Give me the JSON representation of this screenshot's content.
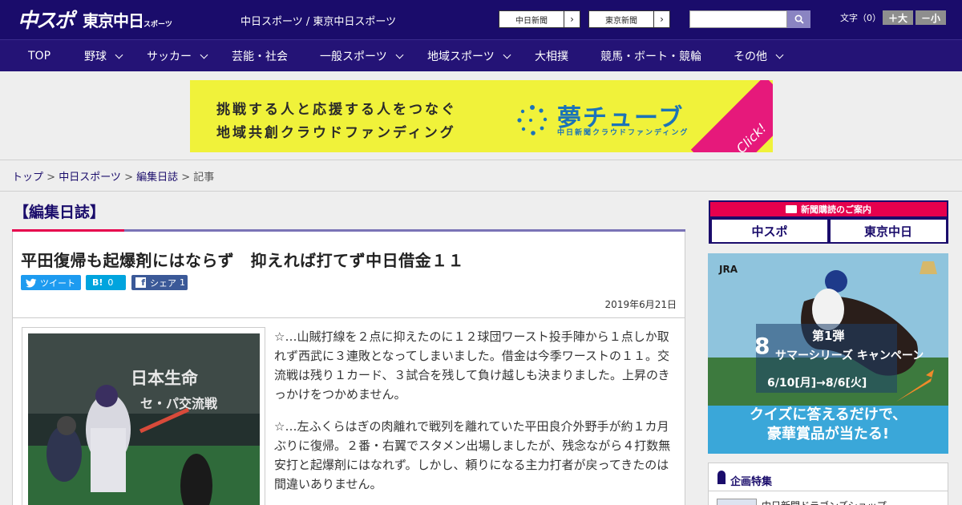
{
  "header": {
    "logo_chunichi": "中スポ",
    "logo_tokyo": "東京中日",
    "logo_tokyo_small": "スポーツ",
    "site_label": "中日スポーツ / 東京中日スポーツ",
    "paper_buttons": [
      "中日新聞",
      "東京新聞"
    ],
    "font_size_label": "文字（0）",
    "font_larger": "＋大",
    "font_smaller": "－小"
  },
  "nav": {
    "items": [
      {
        "label": "TOP"
      },
      {
        "label": "野球"
      },
      {
        "label": "サッカー"
      },
      {
        "label": "芸能・社会"
      },
      {
        "label": "一般スポーツ"
      },
      {
        "label": "地域スポーツ"
      },
      {
        "label": "大相撲"
      },
      {
        "label": "競馬・ボート・競輪"
      },
      {
        "label": "その他"
      }
    ]
  },
  "banner": {
    "line1": "挑戦する人と応援する人をつなぐ",
    "line2": "地域共創クラウドファンディング",
    "brand": "夢チューブ",
    "brand_sub": "中日新聞クラウドファンディング",
    "click": "Click!"
  },
  "breadcrumb": {
    "top": "トップ",
    "site": "中日スポーツ",
    "category": "編集日誌",
    "current": "記事"
  },
  "article": {
    "section": "【編集日誌】",
    "headline": "平田復帰も起爆剤にはならず　抑えれば打てず中日借金１１",
    "tweet_label": "ツイート",
    "hatena_label": "B!",
    "hatena_count": "0",
    "facebook_label": "シェア",
    "facebook_count": "1",
    "date": "2019年6月21日",
    "paragraphs": [
      "☆…山賊打線を２点に抑えたのに１２球団ワースト投手陣から１点しか取れず西武に３連敗となってしまいました。借金は今季ワーストの１１。交流戦は残り１カード、３試合を残して負け越しも決まりました。上昇のきっかけをつかめません。",
      "☆…左ふくらはぎの肉離れで戦列を離れていた平田良介外野手が約１カ月ぶりに復帰。２番・右翼でスタメン出場しましたが、残念ながら４打数無安打と起爆剤にはなれず。しかし、頼りになる主力打者が戻ってきたのは間違いありません。"
    ],
    "photo_sign1": "日本生命",
    "photo_sign2": "セ・パ交流戦"
  },
  "sidebar": {
    "subscribe_head": "新聞購読のご案内",
    "subscribe_chunichi": "中スポ",
    "subscribe_tokyo": "東京中日",
    "jra_logo": "JRA",
    "jra_number": "8",
    "jra_round": "第1弾",
    "jra_campaign": "サマーシリーズ キャンペーン",
    "jra_dates": "6/10[月]→8/6[火]",
    "jra_copy1": "クイズに答えるだけで、",
    "jra_copy2": "豪華賞品が当たる!",
    "kikaku_title": "企画特集",
    "kikaku_item": "中日新聞ドラゴンズショップ"
  },
  "colors": {
    "header_bg": "#1a0c6b",
    "accent_red": "#e6004d",
    "banner_yellow": "#f0f23a",
    "twitter": "#1d9bf0",
    "facebook": "#3b5998",
    "hatena": "#00a4de"
  }
}
